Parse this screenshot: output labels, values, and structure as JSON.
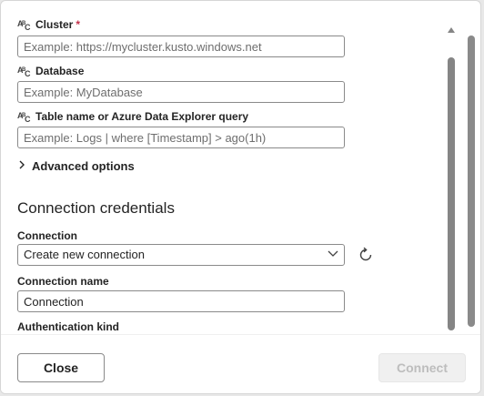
{
  "fields": {
    "cluster": {
      "label": "Cluster",
      "required_mark": "*",
      "placeholder": "Example: https://mycluster.kusto.windows.net"
    },
    "database": {
      "label": "Database",
      "placeholder": "Example: MyDatabase"
    },
    "table": {
      "label": "Table name or Azure Data Explorer query",
      "placeholder": "Example: Logs | where [Timestamp] > ago(1h)"
    }
  },
  "advanced_options": {
    "label": "Advanced options"
  },
  "credentials": {
    "title": "Connection credentials",
    "connection": {
      "label": "Connection",
      "selected": "Create new connection"
    },
    "connection_name": {
      "label": "Connection name",
      "value": "Connection"
    },
    "auth_kind": {
      "label": "Authentication kind"
    }
  },
  "footer": {
    "close_label": "Close",
    "connect_label": "Connect"
  },
  "colors": {
    "required": "#c4314b",
    "scroll_thumb": "#858585",
    "disabled_text": "#bdbdbd"
  }
}
